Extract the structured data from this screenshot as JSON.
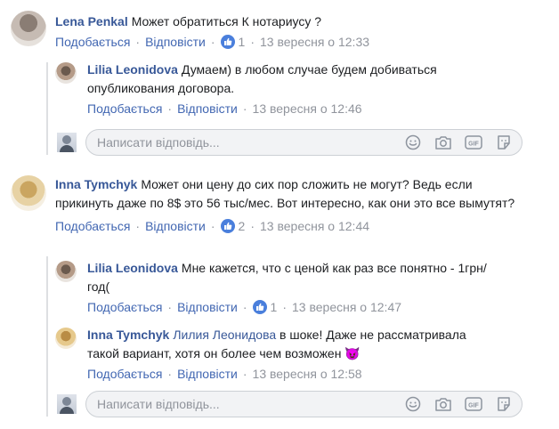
{
  "actions": {
    "like": "Подобається",
    "reply": "Відповісти",
    "separator": "·"
  },
  "reply_box": {
    "placeholder": "Написати відповідь..."
  },
  "comments": [
    {
      "author": "Lena Penkal",
      "text": "Может обратиться К нотариусу ?",
      "likes": "1",
      "time": "13 вересня о 12:33"
    },
    {
      "author": "Inna Tymchyk",
      "text": "Может они цену до сих пор сложить не могут? Ведь если прикинуть даже по 8$ это 56 тыс/мес. Вот интересно, как они это все вымутят?",
      "likes": "2",
      "time": "13 вересня о 12:44"
    }
  ],
  "replies": [
    {
      "author": "Lilia Leonidova",
      "text": "Думаем) в любом случае будем добиваться опубликования договора.",
      "time": "13 вересня о 12:46"
    },
    {
      "author": "Lilia Leonidova",
      "text": "Мне кажется, что с ценой как раз все понятно - 1грн/год(",
      "likes": "1",
      "time": "13 вересня о 12:47"
    },
    {
      "author": "Inna Tymchyk",
      "mention": "Лилия Леонидова",
      "text": "в шоке! Даже не рассматривала такой вариант, хотя он более чем возможен",
      "emoji": "😈",
      "time": "13 вересня о 12:58"
    }
  ]
}
